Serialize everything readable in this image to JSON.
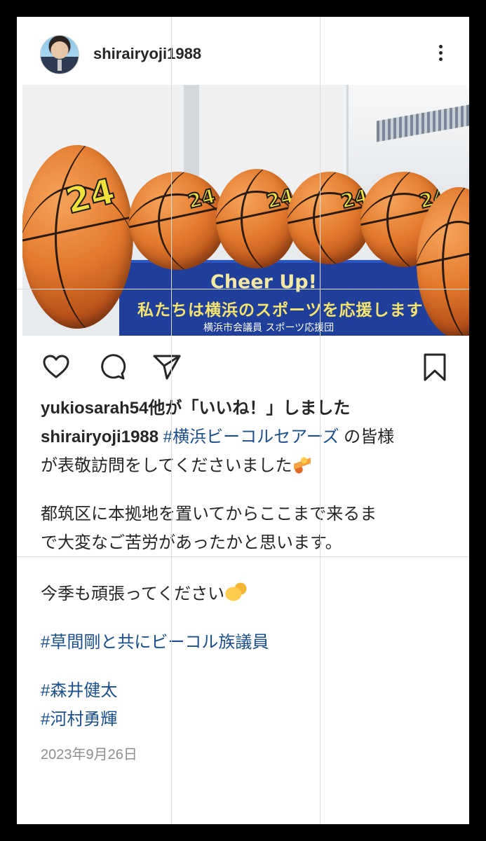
{
  "post": {
    "username": "shirairyoji1988",
    "photo": {
      "banner_title": "Cheer Up!",
      "banner_subtitle": "私たちは横浜のスポーツを応援します",
      "banner_org": "横浜市会議員 スポーツ応援団",
      "ball_number": "24"
    },
    "likes_text": "yukiosarah54他が「いいね！」しました",
    "caption": {
      "author": "shirairyoji1988",
      "tag_team": "#横浜ビーコルセアーズ",
      "line1_after_tag": " の皆様",
      "line2": "が表敬訪問をしてくださいました",
      "line3": "都筑区に本拠地を置いてからここまで来るま",
      "line4": "で大変なご苦労があったかと思います。",
      "line5": "今季も頑張ってください",
      "tag_line1": "#草間剛と共にビーコル族議員",
      "tag_line2": "#森井健太",
      "tag_line3": "#河村勇輝"
    },
    "date": "2023年9月26日"
  },
  "icons": {
    "like": "heart-icon",
    "comment": "comment-icon",
    "share": "send-icon",
    "save": "bookmark-icon",
    "more": "more-icon"
  },
  "colors": {
    "hashtag": "#1b4f8c",
    "text": "#262626",
    "date": "#8e8e8e"
  }
}
